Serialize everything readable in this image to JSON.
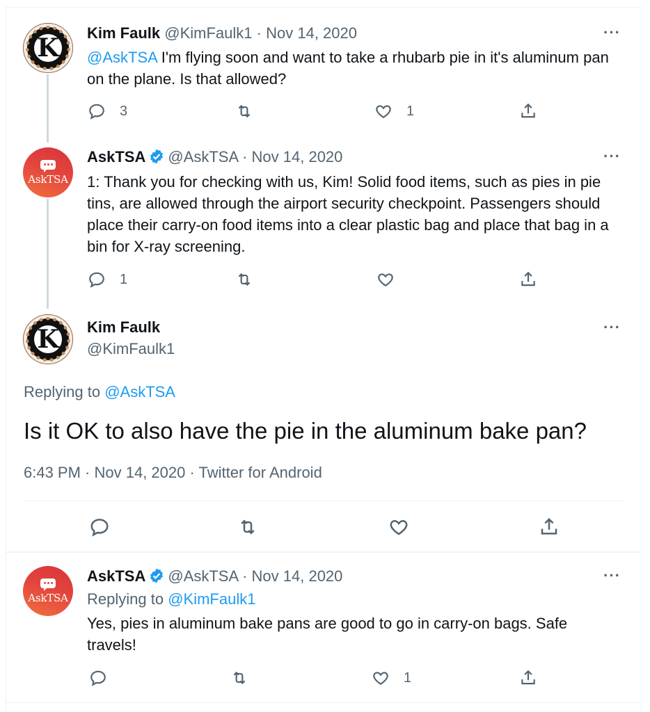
{
  "tweets": [
    {
      "name": "Kim Faulk",
      "handle": "@KimFaulk1",
      "sep": "·",
      "date": "Nov 14, 2020",
      "mention": "@AskTSA",
      "text": " I'm flying soon and want to take a rhubarb pie in it's aluminum pan on the plane. Is that allowed?",
      "replies": "3",
      "retweets": "",
      "likes": "1",
      "more": "···",
      "avatar_letter": "K"
    },
    {
      "name": "AskTSA",
      "handle": "@AskTSA",
      "sep": "·",
      "date": "Nov 14, 2020",
      "text": "1: Thank you for checking with us, Kim! Solid food items, such as pies in pie tins, are allowed through the airport security checkpoint. Passengers should place their carry-on food items into a clear plastic bag and place that bag in a bin for X-ray screening.",
      "replies": "1",
      "retweets": "",
      "likes": "",
      "more": "···",
      "avatar_label": "AskTSA"
    }
  ],
  "focused": {
    "name": "Kim Faulk",
    "handle": "@KimFaulk1",
    "replying_prefix": "Replying to ",
    "replying_to": "@AskTSA",
    "text": "Is it OK to also have the pie in the aluminum bake pan?",
    "meta": "6:43 PM · Nov 14, 2020 · Twitter for Android",
    "more": "···",
    "avatar_letter": "K"
  },
  "reply": {
    "name": "AskTSA",
    "handle": "@AskTSA",
    "sep": "·",
    "date": "Nov 14, 2020",
    "replying_prefix": "Replying to ",
    "replying_to": "@KimFaulk1",
    "text": "Yes, pies in aluminum bake pans are good to go in carry-on bags. Safe travels!",
    "replies": "",
    "retweets": "",
    "likes": "1",
    "more": "···",
    "avatar_label": "AskTSA"
  },
  "colors": {
    "link": "#1d9bf0",
    "secondary_text": "#536471",
    "verified": "#1d9bf0",
    "tsa_avatar": "#e2453d"
  },
  "icons": [
    "reply-icon",
    "retweet-icon",
    "like-icon",
    "share-icon",
    "verified-badge-icon",
    "more-icon"
  ]
}
